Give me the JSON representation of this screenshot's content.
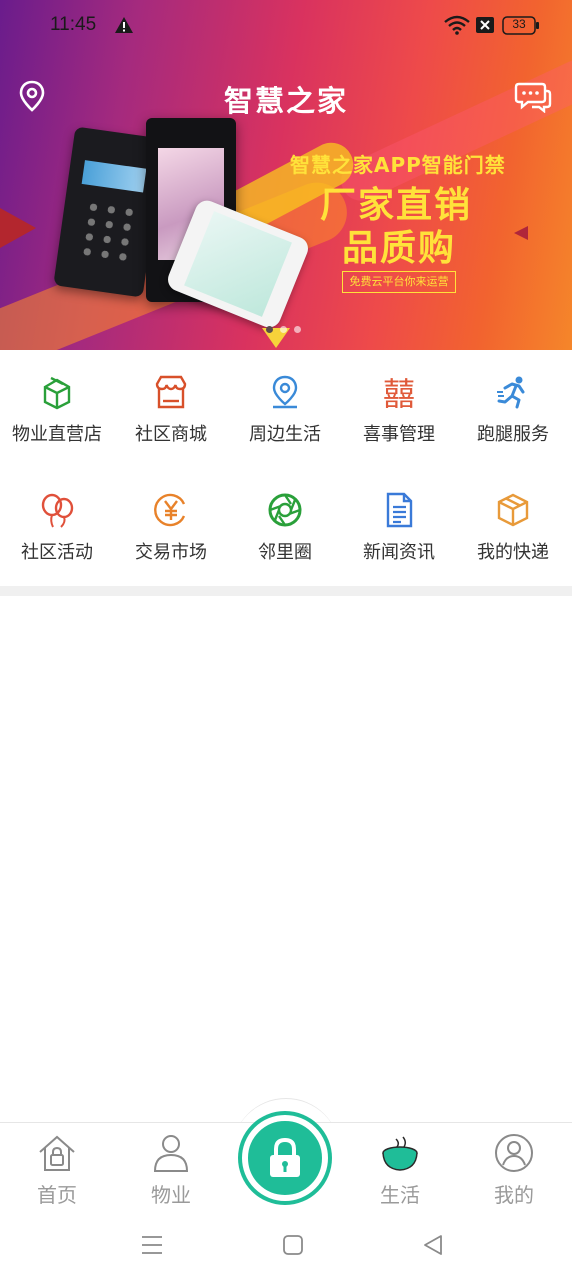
{
  "status_bar": {
    "time": "11:45",
    "battery": "33"
  },
  "header": {
    "title": "智慧之家"
  },
  "banner": {
    "line1": "智慧之家APP智能门禁",
    "line2": "厂家直销",
    "line3": "品质购",
    "button": "免费云平台你来运营"
  },
  "services": [
    {
      "label": "物业直营店",
      "icon": "shop-box-icon",
      "color": "#2aa03a"
    },
    {
      "label": "社区商城",
      "icon": "store-icon",
      "color": "#d8502a"
    },
    {
      "label": "周边生活",
      "icon": "location-pin-icon",
      "color": "#3a8ad8"
    },
    {
      "label": "喜事管理",
      "icon": "double-happiness-icon",
      "color": "#e05a3a"
    },
    {
      "label": "跑腿服务",
      "icon": "runner-icon",
      "color": "#3a8ad8"
    },
    {
      "label": "社区活动",
      "icon": "balloons-icon",
      "color": "#e0503a"
    },
    {
      "label": "交易市场",
      "icon": "yuan-coin-icon",
      "color": "#e8822a"
    },
    {
      "label": "邻里圈",
      "icon": "aperture-icon",
      "color": "#2aa03a"
    },
    {
      "label": "新闻资讯",
      "icon": "document-icon",
      "color": "#3a7ad8"
    },
    {
      "label": "我的快递",
      "icon": "package-icon",
      "color": "#e89a3a"
    }
  ],
  "tabs": [
    {
      "label": "首页",
      "icon": "home-lock-icon"
    },
    {
      "label": "物业",
      "icon": "person-icon"
    },
    {
      "label": "生活",
      "icon": "tea-cup-icon"
    },
    {
      "label": "我的",
      "icon": "profile-circle-icon"
    }
  ],
  "colors": {
    "accent": "#1fbd98",
    "tab_text": "#9a9a9a"
  }
}
